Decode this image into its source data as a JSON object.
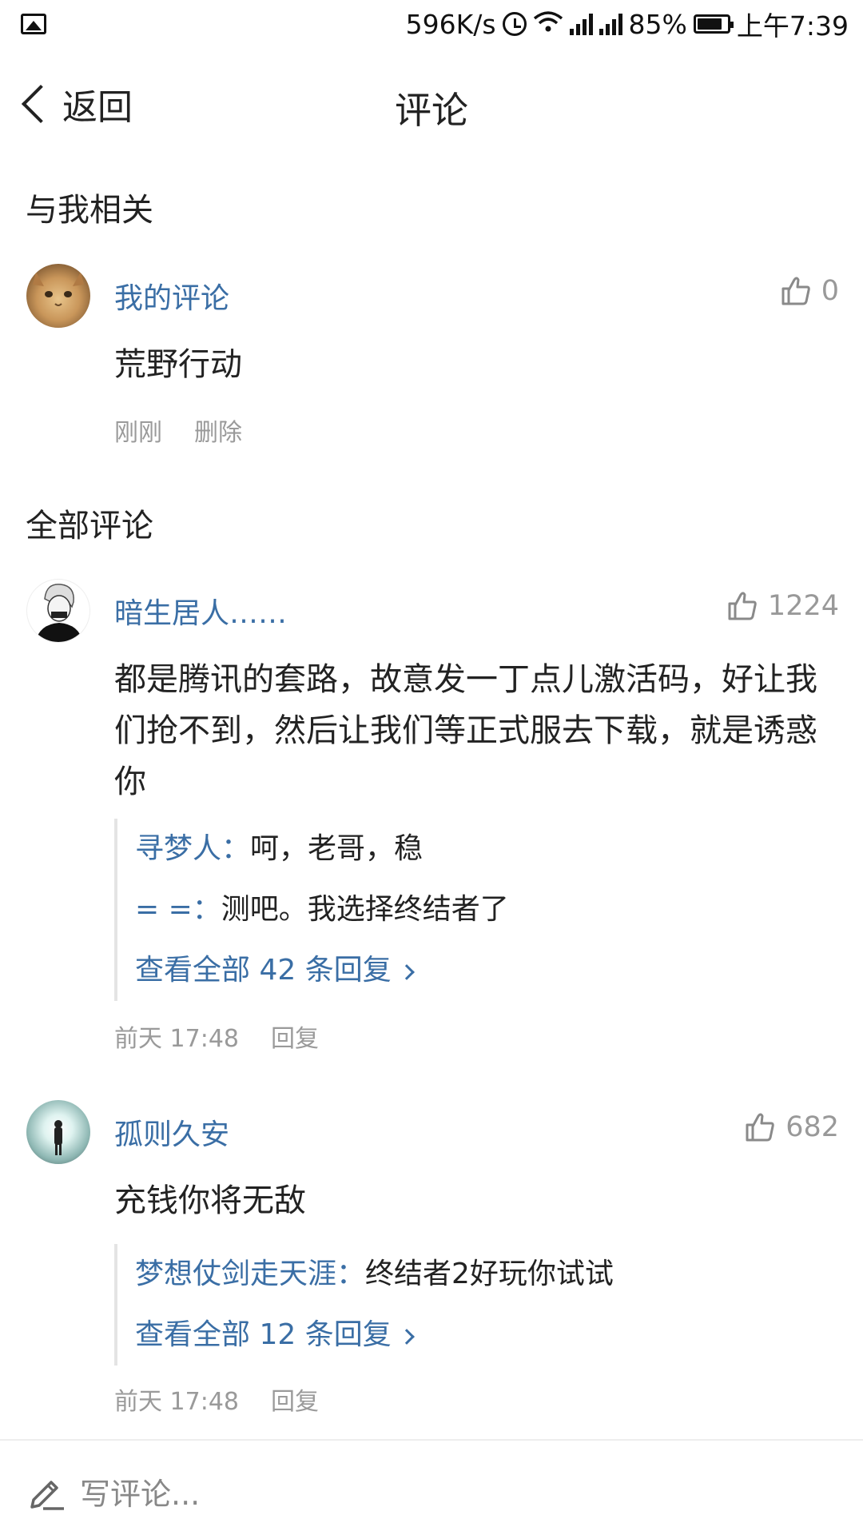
{
  "status_bar": {
    "speed": "596K/s",
    "battery": "85%",
    "time": "上午7:39"
  },
  "nav": {
    "back_label": "返回",
    "title": "评论"
  },
  "sections": {
    "mine": "与我相关",
    "all": "全部评论"
  },
  "my_comment": {
    "username": "我的评论",
    "likes": "0",
    "text": "荒野行动",
    "time": "刚刚",
    "delete_label": "删除"
  },
  "comments": [
    {
      "username": "暗生居人……",
      "likes": "1224",
      "text": "都是腾讯的套路，故意发一丁点儿激活码，好让我们抢不到，然后让我们等正式服去下载，就是诱惑你",
      "replies": [
        {
          "name": "寻梦人：",
          "text": "呵，老哥，稳"
        },
        {
          "name": "= =：",
          "text": "测吧。我选择终结者了"
        }
      ],
      "view_all": "查看全部 42 条回复",
      "time": "前天 17:48",
      "reply_label": "回复"
    },
    {
      "username": "孤则久安",
      "likes": "682",
      "text": "充钱你将无敌",
      "replies": [
        {
          "name": "梦想仗剑走天涯：",
          "text": "终结者2好玩你试试"
        }
      ],
      "view_all": "查看全部 12 条回复",
      "time": "前天 17:48",
      "reply_label": "回复"
    }
  ],
  "bottom": {
    "write_placeholder": "写评论..."
  },
  "colors": {
    "link_blue": "#3a6ea5",
    "meta_gray": "#9a9a9a"
  }
}
